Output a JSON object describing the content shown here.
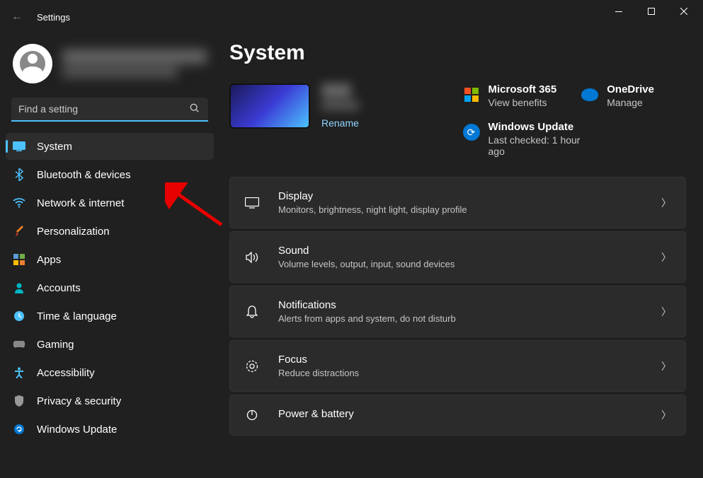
{
  "window": {
    "title": "Settings"
  },
  "search": {
    "placeholder": "Find a setting"
  },
  "nav": {
    "items": [
      {
        "label": "System"
      },
      {
        "label": "Bluetooth & devices"
      },
      {
        "label": "Network & internet"
      },
      {
        "label": "Personalization"
      },
      {
        "label": "Apps"
      },
      {
        "label": "Accounts"
      },
      {
        "label": "Time & language"
      },
      {
        "label": "Gaming"
      },
      {
        "label": "Accessibility"
      },
      {
        "label": "Privacy & security"
      },
      {
        "label": "Windows Update"
      }
    ]
  },
  "page": {
    "title": "System"
  },
  "device": {
    "rename_label": "Rename"
  },
  "cards": {
    "ms365": {
      "title": "Microsoft 365",
      "sub": "View benefits"
    },
    "onedrive": {
      "title": "OneDrive",
      "sub": "Manage"
    },
    "update": {
      "title": "Windows Update",
      "sub": "Last checked: 1 hour ago"
    }
  },
  "settings": [
    {
      "title": "Display",
      "desc": "Monitors, brightness, night light, display profile"
    },
    {
      "title": "Sound",
      "desc": "Volume levels, output, input, sound devices"
    },
    {
      "title": "Notifications",
      "desc": "Alerts from apps and system, do not disturb"
    },
    {
      "title": "Focus",
      "desc": "Reduce distractions"
    },
    {
      "title": "Power & battery",
      "desc": ""
    }
  ]
}
